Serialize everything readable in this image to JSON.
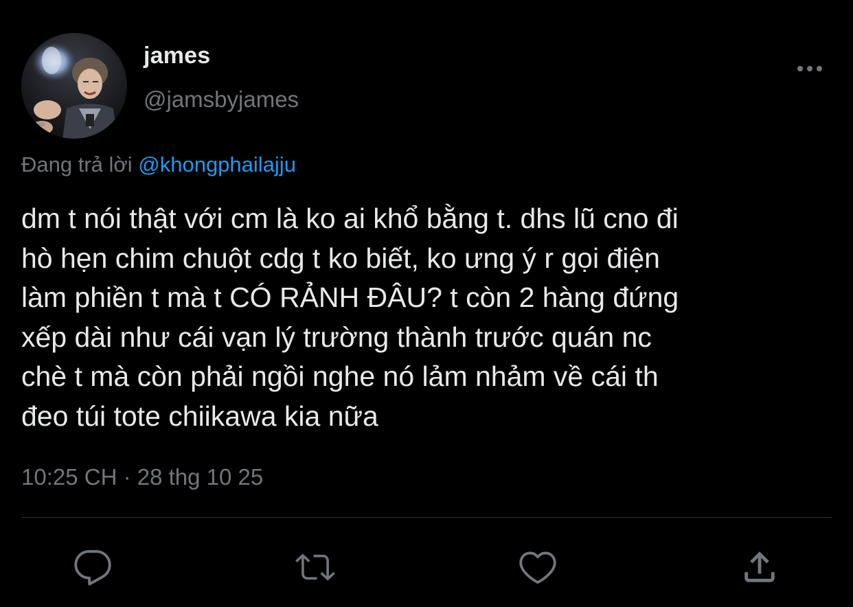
{
  "user": {
    "display_name": "james",
    "handle": "@jamsbyjames",
    "avatar_icon": "profile-photo"
  },
  "reply": {
    "prefix": "Đang trả lời",
    "mention": "@khongphailajju"
  },
  "tweet": {
    "text": "dm t nói thật với cm là ko ai khổ bằng t. dhs lũ cno đi\nhò hẹn chim chuột cdg t ko biết, ko ưng ý r gọi điện\nlàm phiền t mà t CÓ RẢNH ĐÂU? t còn 2 hàng đứng\nxếp dài như cái vạn lý trường thành trước quán nc\nchè t mà còn phải ngồi nghe nó lảm nhảm về cái th\nđeo túi tote chiikawa kia nữa",
    "timestamp": "10:25 CH · 28 thg 10 25"
  },
  "actions": [
    {
      "name": "reply",
      "icon": "comment-icon"
    },
    {
      "name": "retweet",
      "icon": "retweet-icon"
    },
    {
      "name": "like",
      "icon": "heart-icon"
    },
    {
      "name": "share",
      "icon": "share-icon"
    }
  ],
  "colors": {
    "background": "#000000",
    "text_primary": "#e7e9ea",
    "text_secondary": "#71767b",
    "accent": "#1d9bf0",
    "divider": "#2f3336"
  }
}
